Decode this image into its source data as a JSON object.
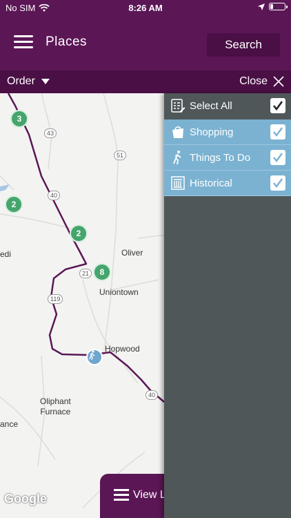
{
  "status_bar": {
    "carrier": "No SIM",
    "time": "8:26 AM"
  },
  "header": {
    "title": "Places",
    "search_label": "Search"
  },
  "order_bar": {
    "order_label": "Order",
    "close_label": "Close"
  },
  "map": {
    "clusters": [
      {
        "count": "3"
      },
      {
        "count": "2"
      },
      {
        "count": "2"
      },
      {
        "count": "8"
      }
    ],
    "place_labels": [
      "Oliver",
      "Uniontown",
      "Hopwood",
      "Oliphant\nFurnace",
      "edi",
      "ance"
    ],
    "route_shields": [
      "43",
      "51",
      "40",
      "21",
      "119",
      "40"
    ],
    "attribution": "Google",
    "view_list_label": "View L"
  },
  "filter_panel": {
    "items": [
      {
        "label": "Select All",
        "checked": true,
        "icon": "list-edit-icon"
      },
      {
        "label": "Shopping",
        "checked": true,
        "icon": "shopping-bag-icon"
      },
      {
        "label": "Things To Do",
        "checked": true,
        "icon": "hiker-icon"
      },
      {
        "label": "Historical",
        "checked": true,
        "icon": "historical-building-icon"
      }
    ]
  },
  "colors": {
    "brand_purple": "#5b1656",
    "brand_purple_dark": "#4a0f45",
    "selected_row": "#7bb2d1",
    "panel_bg": "#4f5759",
    "cluster_green": "#45a56c",
    "route": "#5b1656"
  }
}
